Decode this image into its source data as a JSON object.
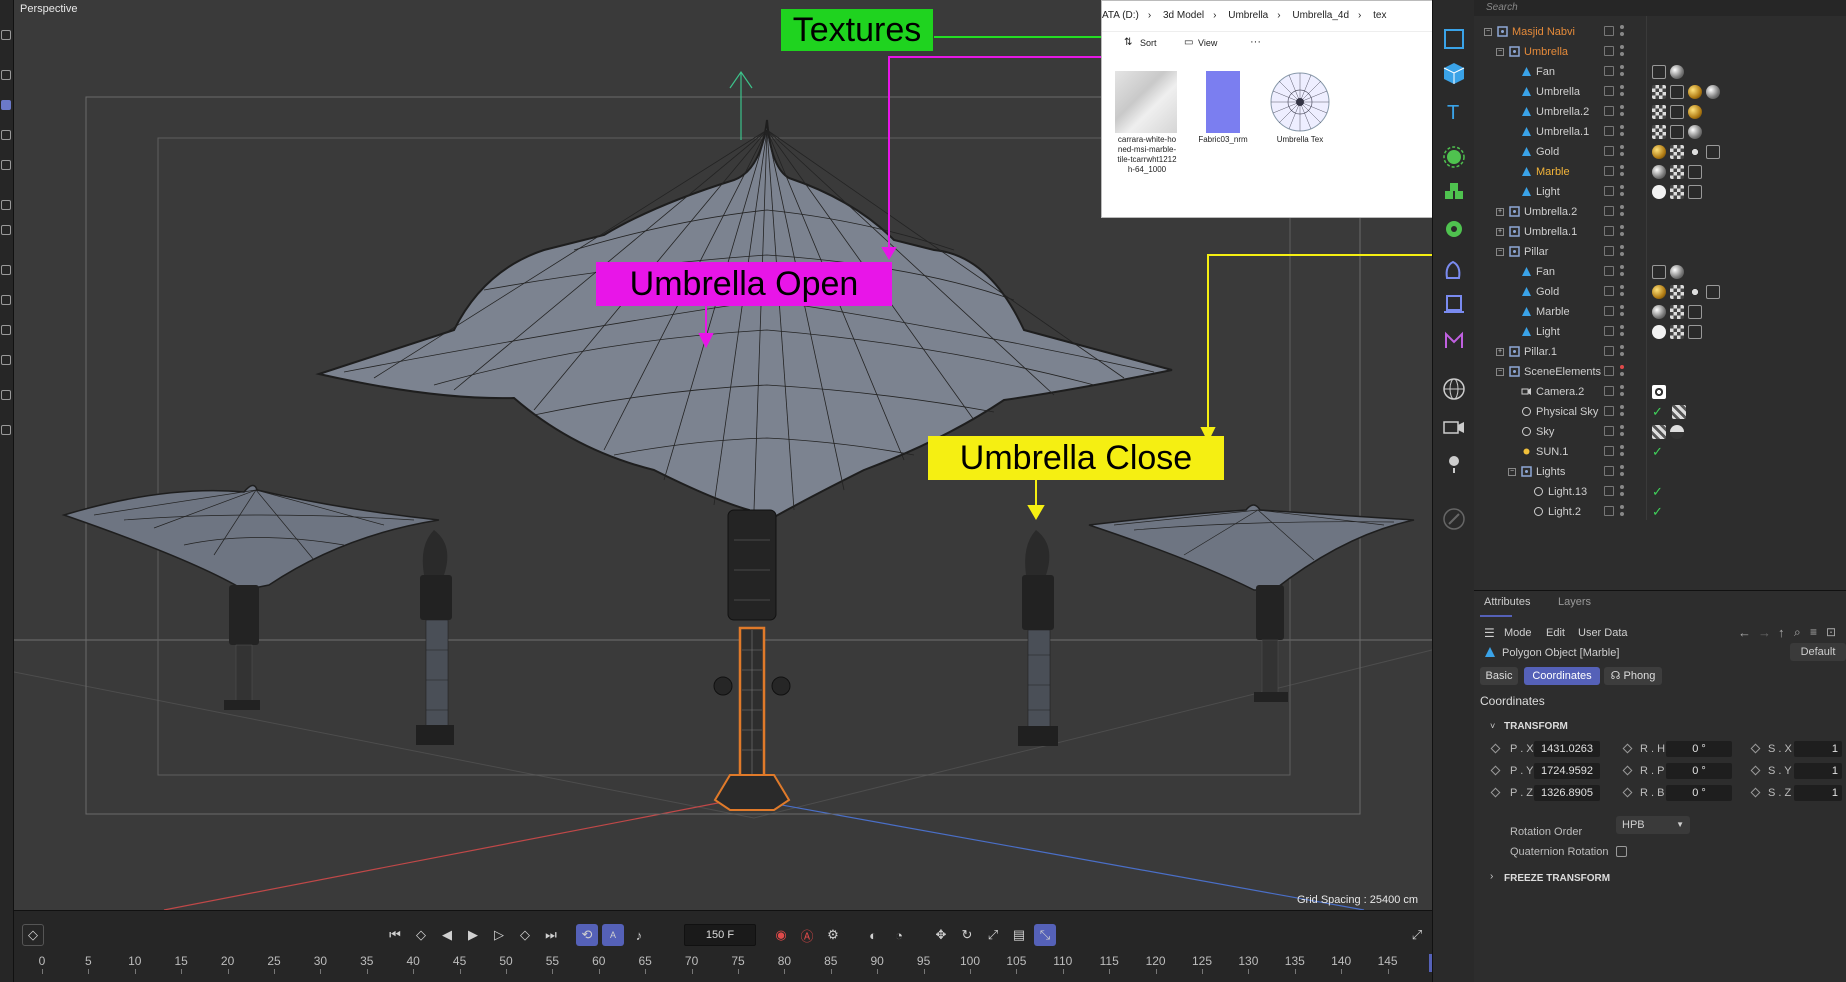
{
  "viewport": {
    "camera_label": "Perspective",
    "grid_spacing": "Grid Spacing : 25400 cm"
  },
  "callouts": {
    "textures": {
      "label": "Textures",
      "color": "#1fd31f"
    },
    "umbrella_open": {
      "label": "Umbrella Open",
      "color": "#e815e8"
    },
    "umbrella_close": {
      "label": "Umbrella Close",
      "color": "#f5ef12"
    }
  },
  "explorer": {
    "breadcrumb": [
      "ATA (D:)",
      "3d Model",
      "Umbrella",
      "Umbrella_4d",
      "tex"
    ],
    "sort_label": "Sort",
    "view_label": "View",
    "more_label": "···",
    "files": [
      {
        "name": "carrara-white-ho ned-msi-marble-tile-tcarrwht1212 h-64_1000",
        "lines": [
          "carrara-white-ho",
          "ned-msi-marble-",
          "tile-tcarrwht1212",
          "h-64_1000"
        ]
      },
      {
        "name": "Fabric03_nrm",
        "lines": [
          "Fabric03_nrm"
        ]
      },
      {
        "name": "Umbrella Tex",
        "lines": [
          "Umbrella Tex"
        ]
      }
    ]
  },
  "object_manager": {
    "search_placeholder": "Search",
    "rows": [
      {
        "name": "Masjid Nabvi",
        "indent": 0,
        "type": "null",
        "expander": "-",
        "color": "#e48a3a"
      },
      {
        "name": "Umbrella",
        "indent": 1,
        "type": "null",
        "expander": "-",
        "color": "#e48a3a"
      },
      {
        "name": "Fan",
        "indent": 2,
        "type": "poly",
        "expander": "",
        "color": "#cfcfcf",
        "tags": [
          "phong",
          "sphere"
        ]
      },
      {
        "name": "Umbrella",
        "indent": 2,
        "type": "poly",
        "expander": "",
        "color": "#cfcfcf",
        "tags": [
          "checker",
          "phong",
          "gold",
          "sphere"
        ]
      },
      {
        "name": "Umbrella.2",
        "indent": 2,
        "type": "poly",
        "expander": "",
        "color": "#cfcfcf",
        "tags": [
          "checker",
          "phong",
          "gold"
        ]
      },
      {
        "name": "Umbrella.1",
        "indent": 2,
        "type": "poly",
        "expander": "",
        "color": "#cfcfcf",
        "tags": [
          "checker",
          "phong",
          "sphere"
        ]
      },
      {
        "name": "Gold",
        "indent": 2,
        "type": "poly",
        "expander": "",
        "color": "#cfcfcf",
        "tags": [
          "gold",
          "checker",
          "gear",
          "phong"
        ]
      },
      {
        "name": "Marble",
        "indent": 2,
        "type": "poly",
        "expander": "",
        "color": "#f1b33a",
        "tags": [
          "sphere",
          "checker",
          "phong"
        ]
      },
      {
        "name": "Light",
        "indent": 2,
        "type": "poly",
        "expander": "",
        "color": "#cfcfcf",
        "tags": [
          "white",
          "checker",
          "phong"
        ]
      },
      {
        "name": "Umbrella.2",
        "indent": 1,
        "type": "null",
        "expander": "+",
        "color": "#cfcfcf"
      },
      {
        "name": "Umbrella.1",
        "indent": 1,
        "type": "null",
        "expander": "+",
        "color": "#cfcfcf"
      },
      {
        "name": "Pillar",
        "indent": 1,
        "type": "null",
        "expander": "-",
        "color": "#cfcfcf"
      },
      {
        "name": "Fan",
        "indent": 2,
        "type": "poly",
        "expander": "",
        "color": "#cfcfcf",
        "tags": [
          "phong",
          "sphere"
        ]
      },
      {
        "name": "Gold",
        "indent": 2,
        "type": "poly",
        "expander": "",
        "color": "#cfcfcf",
        "tags": [
          "gold",
          "checker",
          "gear",
          "phong"
        ]
      },
      {
        "name": "Marble",
        "indent": 2,
        "type": "poly",
        "expander": "",
        "color": "#cfcfcf",
        "tags": [
          "sphere",
          "checker",
          "phong"
        ]
      },
      {
        "name": "Light",
        "indent": 2,
        "type": "poly",
        "expander": "",
        "color": "#cfcfcf",
        "tags": [
          "white",
          "checker",
          "phong"
        ]
      },
      {
        "name": "Pillar.1",
        "indent": 1,
        "type": "null",
        "expander": "+",
        "color": "#cfcfcf"
      },
      {
        "name": "SceneElements",
        "indent": 1,
        "type": "null",
        "expander": "-",
        "color": "#cfcfcf",
        "reddot": true
      },
      {
        "name": "Camera.2",
        "indent": 2,
        "type": "camera",
        "expander": "",
        "color": "#cfcfcf",
        "tags": [
          "target"
        ]
      },
      {
        "name": "Physical Sky",
        "indent": 2,
        "type": "sky",
        "expander": "",
        "color": "#cfcfcf",
        "check": true,
        "tags": [
          "clapper"
        ]
      },
      {
        "name": "Sky",
        "indent": 2,
        "type": "sky",
        "expander": "",
        "color": "#cfcfcf",
        "tags": [
          "clapper",
          "skyball"
        ]
      },
      {
        "name": "SUN.1",
        "indent": 2,
        "type": "sun",
        "expander": "",
        "color": "#cfcfcf",
        "check": true
      },
      {
        "name": "Lights",
        "indent": 2,
        "type": "null",
        "expander": "-",
        "color": "#cfcfcf"
      },
      {
        "name": "Light.13",
        "indent": 3,
        "type": "light",
        "expander": "",
        "color": "#cfcfcf",
        "check": true
      },
      {
        "name": "Light.2",
        "indent": 3,
        "type": "light",
        "expander": "",
        "color": "#cfcfcf",
        "check": true
      }
    ]
  },
  "attributes": {
    "tabs": [
      "Attributes",
      "Layers"
    ],
    "menu": [
      "Mode",
      "Edit",
      "User Data"
    ],
    "object_title": "Polygon Object [Marble]",
    "preset": "Default",
    "subtabs": [
      "Basic",
      "Coordinates",
      "Phong"
    ],
    "section_title": "Coordinates",
    "transform_label": "TRANSFORM",
    "pos": [
      {
        "label": "P . X",
        "value": "1431.0263"
      },
      {
        "label": "P . Y",
        "value": "1724.9592"
      },
      {
        "label": "P . Z",
        "value": "1326.8905"
      }
    ],
    "rot": [
      {
        "label": "R . H",
        "value": "0 °"
      },
      {
        "label": "R . P",
        "value": "0 °"
      },
      {
        "label": "R . B",
        "value": "0 °"
      }
    ],
    "scale": [
      {
        "label": "S . X",
        "value": "1"
      },
      {
        "label": "S . Y",
        "value": "1"
      },
      {
        "label": "S . Z",
        "value": "1"
      }
    ],
    "rotation_order_label": "Rotation Order",
    "rotation_order_value": "HPB",
    "quaternion_label": "Quaternion Rotation",
    "freeze_label": "FREEZE TRANSFORM"
  },
  "timeline": {
    "current_frame": "150 F",
    "ticks": [
      "0",
      "5",
      "10",
      "15",
      "20",
      "25",
      "30",
      "35",
      "40",
      "45",
      "50",
      "55",
      "60",
      "65",
      "70",
      "75",
      "80",
      "85",
      "90",
      "95",
      "100",
      "105",
      "110",
      "115",
      "120",
      "125",
      "130",
      "135",
      "140",
      "145",
      "1"
    ]
  }
}
